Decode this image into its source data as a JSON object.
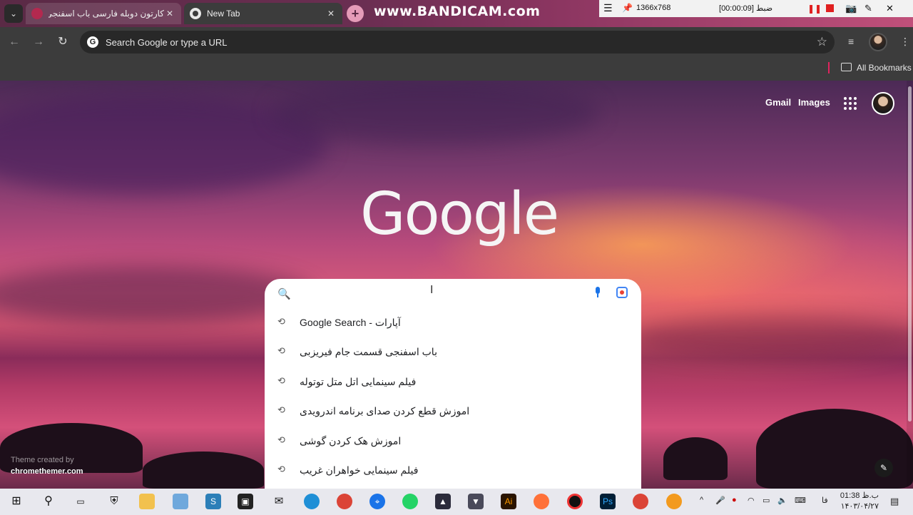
{
  "tabs": [
    {
      "title": "کارتون دوبله فارسی باب اسفنجی",
      "active": false
    },
    {
      "title": "New Tab",
      "active": true
    }
  ],
  "recorder": {
    "watermark": "www.BANDICAM.com",
    "resolution": "1366x768",
    "status": "ضبط [00:00:09]"
  },
  "toolbar": {
    "omnibox_placeholder": "Search Google or type a URL",
    "bookmarks_label": "All Bookmarks"
  },
  "page": {
    "links": [
      "Gmail",
      "Images"
    ],
    "logo": "Google",
    "search_placeholder": "",
    "suggestions": [
      "آپارات - Google Search",
      "باب اسفنجی قسمت جام فیریزبی",
      "فیلم سینمایی اتل متل توتوله",
      "اموزش قطع کردن صدای برنامه اندرویدی",
      "اموزش هک کردن گوشی",
      "فیلم سینمایی خواهران غریب"
    ],
    "theme_credit": "Theme created by",
    "theme_site": "chromethemer.com"
  },
  "taskbar": {
    "lang": "فا",
    "time": "ب.ظ 01:38",
    "date": "۱۴۰۳/۰۴/۲۷"
  }
}
